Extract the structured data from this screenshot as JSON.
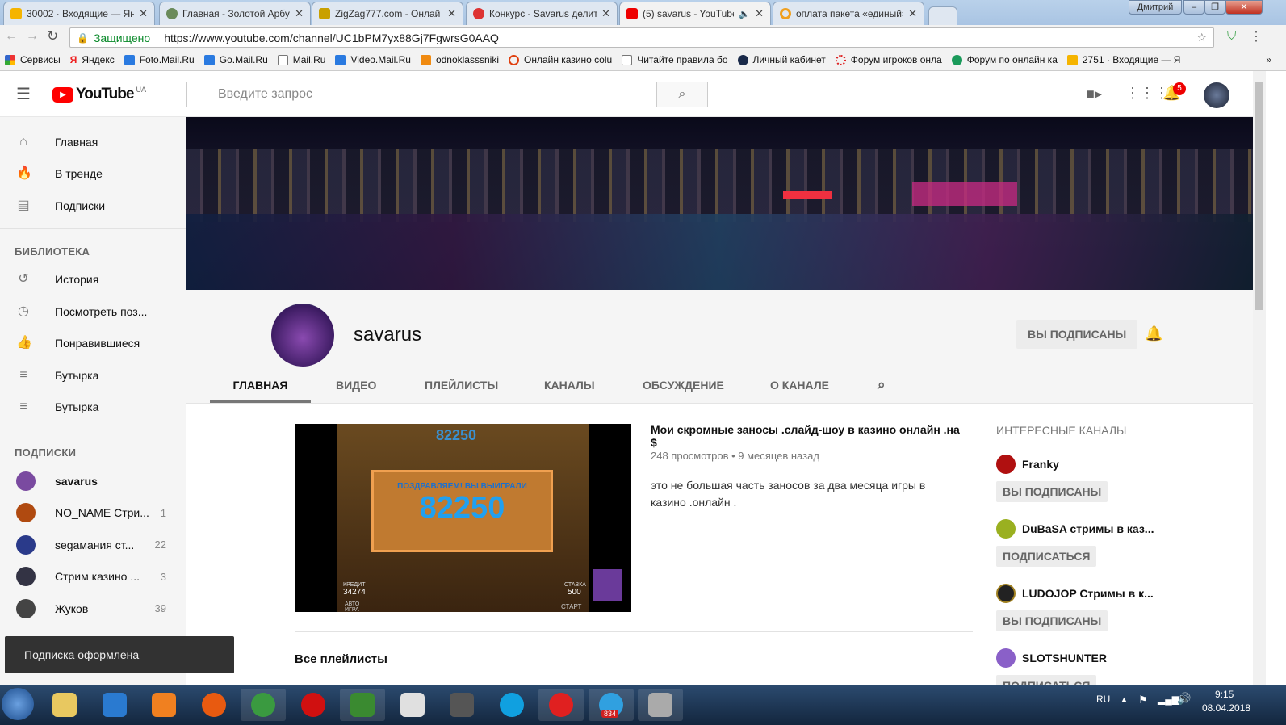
{
  "browser": {
    "tabs": [
      {
        "title": "30002 · Входящие — Ян",
        "color": "#f5b400"
      },
      {
        "title": "Главная - Золотой Арбу",
        "color": "#6a8a5a"
      },
      {
        "title": "ZigZag777.com - Онлай",
        "color": "#c9a000"
      },
      {
        "title": "Конкурс - Savarus делит",
        "color": "#d33"
      },
      {
        "title": "(5) savarus - YouTube",
        "color": "#e00",
        "active": true
      },
      {
        "title": "оплата пакета «единый»",
        "color": "#f0a020"
      }
    ],
    "user": "Дмитрий",
    "secure_label": "Защищено",
    "url": "https://www.youtube.com/channel/UC1bPM7yx88Gj7FgwrsG0AAQ",
    "bookmarks": [
      "Сервисы",
      "Яндекс",
      "Foto.Mail.Ru",
      "Go.Mail.Ru",
      "Mail.Ru",
      "Video.Mail.Ru",
      "odnoklasssniki",
      "Онлайн казино colu",
      "Читайте правила бо",
      "Личный кабинет",
      "Форум игроков онла",
      "Форум по онлайн ка",
      "2751 · Входящие — Я"
    ],
    "more": "»"
  },
  "yt": {
    "logo": "YouTube",
    "region": "UA",
    "search_placeholder": "Введите запрос",
    "notif_count": "5"
  },
  "sidebar": {
    "main": [
      "Главная",
      "В тренде",
      "Подписки"
    ],
    "library_title": "БИБЛИОТЕКА",
    "library": [
      "История",
      "Посмотреть поз...",
      "Понравившиеся",
      "Бутырка",
      "Бутырка"
    ],
    "subs_title": "ПОДПИСКИ",
    "subs": [
      {
        "name": "savarus",
        "count": "",
        "color": "#7a4aa0"
      },
      {
        "name": "NO_NAME Стри...",
        "count": "1",
        "color": "#b04a10"
      },
      {
        "name": "segaмания ст...",
        "count": "22",
        "color": "#2a3a8a"
      },
      {
        "name": "Стрим казино ...",
        "count": "3",
        "color": "#334"
      },
      {
        "name": "Жуков",
        "count": "39",
        "color": "#444"
      }
    ]
  },
  "channel": {
    "name": "savarus",
    "subscribed_label": "ВЫ ПОДПИСАНЫ",
    "tabs": [
      "ГЛАВНАЯ",
      "ВИДЕО",
      "ПЛЕЙЛИСТЫ",
      "КАНАЛЫ",
      "ОБСУЖДЕНИЕ",
      "О КАНАЛЕ"
    ]
  },
  "video": {
    "title": "Мои скромные заносы .слайд-шоу в казино онлайн .на $",
    "meta": "248 просмотров • 9 месяцев назад",
    "description": "это  не большая часть заносов за два месяца игры в казино .онлайн .",
    "thumb_top": "82250",
    "thumb_banner": "ПОЗДРАВЛЯЕМ! ВЫ ВЫИГРАЛИ",
    "thumb_win": "82250",
    "thumb_credit_label": "КРЕДИТ",
    "thumb_credit": "34274",
    "thumb_bet_label": "СТАВКА",
    "thumb_bet": "500",
    "thumb_auto": "АВТО ИГРА",
    "thumb_start": "СТАРТ"
  },
  "playlists_title": "Все плейлисты",
  "related": {
    "title": "ИНТЕРЕСНЫЕ КАНАЛЫ",
    "channels": [
      {
        "name": "Franky",
        "button": "ВЫ ПОДПИСАНЫ",
        "color": "#b01010"
      },
      {
        "name": "DuBaSA стримы в каз...",
        "button": "ПОДПИСАТЬСЯ",
        "color": "#9ab020"
      },
      {
        "name": "LUDOJOP Стримы в к...",
        "button": "ВЫ ПОДПИСАНЫ",
        "color": "#222"
      },
      {
        "name": "SLOTSHUNTER",
        "button": "ПОДПИСАТЬСЯ",
        "color": "#8a60c8"
      }
    ]
  },
  "toast": "Подписка оформлена",
  "taskbar": {
    "apps": [
      {
        "name": "explorer",
        "color": "#e8c860"
      },
      {
        "name": "internet-explorer",
        "color": "#2a7ad0"
      },
      {
        "name": "media-player",
        "color": "#f08020"
      },
      {
        "name": "firefox",
        "color": "#e85a10"
      },
      {
        "name": "chrome",
        "color": "#3a9a40"
      },
      {
        "name": "opera",
        "color": "#d01010"
      },
      {
        "name": "camtasia",
        "color": "#3a8a30"
      },
      {
        "name": "yandex",
        "color": "#e0e0e0"
      },
      {
        "name": "world-of-tanks",
        "color": "#555"
      },
      {
        "name": "skype",
        "color": "#10a0e0"
      },
      {
        "name": "yandex-browser",
        "color": "#e02020"
      },
      {
        "name": "telegram",
        "color": "#30a0e0"
      },
      {
        "name": "tools",
        "color": "#aaa"
      }
    ],
    "telegram_badge": "834",
    "lang": "RU",
    "time": "9:15",
    "date": "08.04.2018"
  }
}
